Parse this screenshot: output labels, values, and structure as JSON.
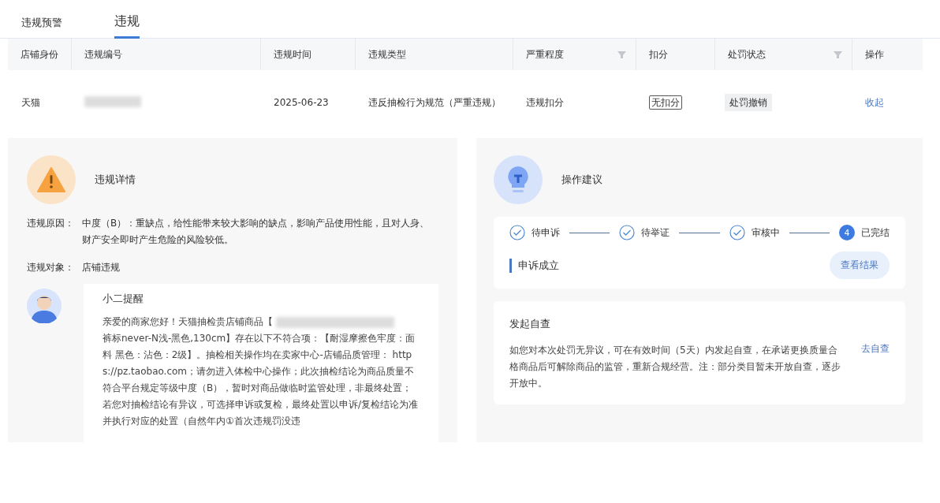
{
  "tabs": [
    {
      "label": "违规预警",
      "selected": false
    },
    {
      "label": "违规",
      "selected": true
    }
  ],
  "table": {
    "columns": [
      {
        "label": "店铺身份",
        "filter": false
      },
      {
        "label": "违规编号",
        "filter": false
      },
      {
        "label": "违规时间",
        "filter": false
      },
      {
        "label": "违规类型",
        "filter": false
      },
      {
        "label": "严重程度",
        "filter": true
      },
      {
        "label": "扣分",
        "filter": false
      },
      {
        "label": "处罚状态",
        "filter": true
      },
      {
        "label": "操作",
        "filter": false
      }
    ],
    "rows": [
      {
        "shop": "天猫",
        "time": "2025-06-23",
        "type": "违反抽检行为规范（严重违规）",
        "severity": "违规扣分",
        "points": "无扣分",
        "status": "处罚撤销",
        "action": "收起"
      }
    ]
  },
  "details": {
    "title": "违规详情",
    "fields": [
      {
        "label": "违规原因：",
        "value": "中度（B）：重缺点，给性能带来较大影响的缺点，影响产品使用性能，且对人身、财产安全即时产生危险的风险较低。"
      },
      {
        "label": "违规对象：",
        "value": "店铺违规"
      }
    ],
    "notice": {
      "title": "小二提醒",
      "text_before": "亲爱的商家您好！天猫抽检贵店铺商品【",
      "text_after": "裤标never-N浅-黑色,130cm】存在以下不符合项：【耐湿摩擦色牢度：面料 黑色：沾色：2级】。抽检相关操作均在卖家中心-店铺品质管理： https://pz.taobao.com；请勿进入体检中心操作；此次抽检结论为商品质量不符合平台规定等级中度（B），暂时对商品做临时监管处理，非最终处置；若您对抽检结论有异议，可选择申诉或复检，最终处置以申诉/复检结论为准并执行对应的处置（自然年内①首次违规罚没违"
    }
  },
  "advice": {
    "title": "操作建议",
    "steps": [
      {
        "label": "待申诉",
        "done": true
      },
      {
        "label": "待举证",
        "done": true
      },
      {
        "label": "审核中",
        "done": true
      },
      {
        "label": "已完结",
        "done": false,
        "number": "4"
      }
    ],
    "result": {
      "label": "申诉成立",
      "button": "查看结果"
    },
    "self_check": {
      "title": "发起自查",
      "text": "如您对本次处罚无异议，可在有效时间（5天）内发起自查，在承诺更换质量合格商品后可解除商品的监管，重新合规经营。注：部分类目暂未开放自查，逐步开放中。",
      "link": "去自查"
    }
  }
}
